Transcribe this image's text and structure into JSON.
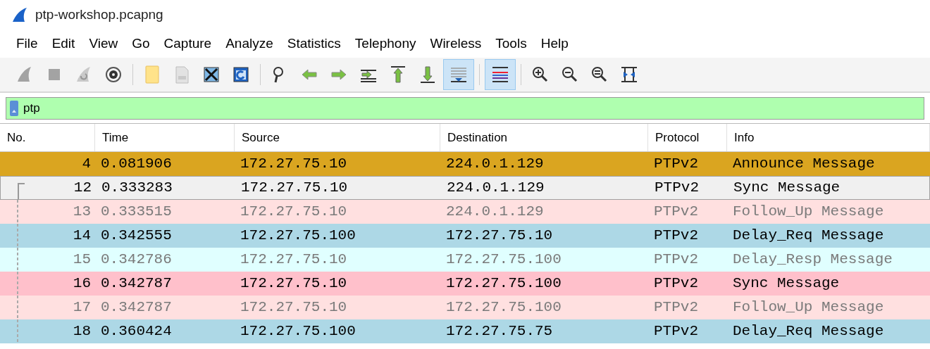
{
  "window": {
    "title": "ptp-workshop.pcapng"
  },
  "menu": [
    {
      "label": "File"
    },
    {
      "label": "Edit"
    },
    {
      "label": "View"
    },
    {
      "label": "Go"
    },
    {
      "label": "Capture"
    },
    {
      "label": "Analyze"
    },
    {
      "label": "Statistics"
    },
    {
      "label": "Telephony"
    },
    {
      "label": "Wireless"
    },
    {
      "label": "Tools"
    },
    {
      "label": "Help"
    }
  ],
  "toolbar": [
    {
      "kind": "start",
      "pressed": false,
      "disabled": true
    },
    {
      "kind": "stop",
      "pressed": false,
      "disabled": true
    },
    {
      "kind": "restart",
      "pressed": false,
      "disabled": true
    },
    {
      "kind": "options",
      "pressed": false,
      "disabled": false
    },
    {
      "kind": "separator"
    },
    {
      "kind": "open",
      "pressed": false,
      "disabled": false
    },
    {
      "kind": "save",
      "pressed": false,
      "disabled": true
    },
    {
      "kind": "close",
      "pressed": false,
      "disabled": false
    },
    {
      "kind": "reload",
      "pressed": false,
      "disabled": false
    },
    {
      "kind": "separator"
    },
    {
      "kind": "find",
      "pressed": false,
      "disabled": false
    },
    {
      "kind": "back",
      "pressed": false,
      "disabled": false
    },
    {
      "kind": "forward",
      "pressed": false,
      "disabled": false
    },
    {
      "kind": "goto",
      "pressed": false,
      "disabled": false
    },
    {
      "kind": "first",
      "pressed": false,
      "disabled": false
    },
    {
      "kind": "last",
      "pressed": false,
      "disabled": false
    },
    {
      "kind": "autoscroll",
      "pressed": true,
      "disabled": false
    },
    {
      "kind": "separator"
    },
    {
      "kind": "colorize",
      "pressed": true,
      "disabled": false
    },
    {
      "kind": "separator"
    },
    {
      "kind": "zoom_in",
      "pressed": false,
      "disabled": false
    },
    {
      "kind": "zoom_out",
      "pressed": false,
      "disabled": false
    },
    {
      "kind": "zoom_normal",
      "pressed": false,
      "disabled": false
    },
    {
      "kind": "resize",
      "pressed": false,
      "disabled": false
    }
  ],
  "filter": {
    "value": "ptp",
    "valid": true
  },
  "table": {
    "columns": [
      "No.",
      "Time",
      "Source",
      "Destination",
      "Protocol",
      "Info"
    ],
    "rows": [
      {
        "cells": [
          "4",
          "0.081906",
          "172.27.75.10",
          "224.0.1.129",
          "PTPv2",
          "Announce Message"
        ],
        "color": "#daa520",
        "dimmed": false,
        "selected": false,
        "kind": "plain"
      },
      {
        "cells": [
          "12",
          "0.333283",
          "172.27.75.10",
          "224.0.1.129",
          "PTPv2",
          "Sync Message"
        ],
        "color": "#f0f0f0",
        "dimmed": false,
        "selected": true,
        "kind": "related_start"
      },
      {
        "cells": [
          "13",
          "0.333515",
          "172.27.75.10",
          "224.0.1.129",
          "PTPv2",
          "Follow_Up Message"
        ],
        "color": "#ffe0e0",
        "dimmed": true,
        "selected": false,
        "kind": "related"
      },
      {
        "cells": [
          "14",
          "0.342555",
          "172.27.75.100",
          "172.27.75.10",
          "PTPv2",
          "Delay_Req Message"
        ],
        "color": "#add8e6",
        "dimmed": false,
        "selected": false,
        "kind": "related"
      },
      {
        "cells": [
          "15",
          "0.342786",
          "172.27.75.10",
          "172.27.75.100",
          "PTPv2",
          "Delay_Resp Message"
        ],
        "color": "#e0ffff",
        "dimmed": true,
        "selected": false,
        "kind": "related"
      },
      {
        "cells": [
          "16",
          "0.342787",
          "172.27.75.10",
          "172.27.75.100",
          "PTPv2",
          "Sync Message"
        ],
        "color": "#ffc0cb",
        "dimmed": false,
        "selected": false,
        "kind": "related"
      },
      {
        "cells": [
          "17",
          "0.342787",
          "172.27.75.10",
          "172.27.75.100",
          "PTPv2",
          "Follow_Up Message"
        ],
        "color": "#ffe0e0",
        "dimmed": true,
        "selected": false,
        "kind": "related"
      },
      {
        "cells": [
          "18",
          "0.360424",
          "172.27.75.100",
          "172.27.75.75",
          "PTPv2",
          "Delay_Req Message"
        ],
        "color": "#add8e6",
        "dimmed": false,
        "selected": false,
        "kind": "related"
      }
    ]
  }
}
